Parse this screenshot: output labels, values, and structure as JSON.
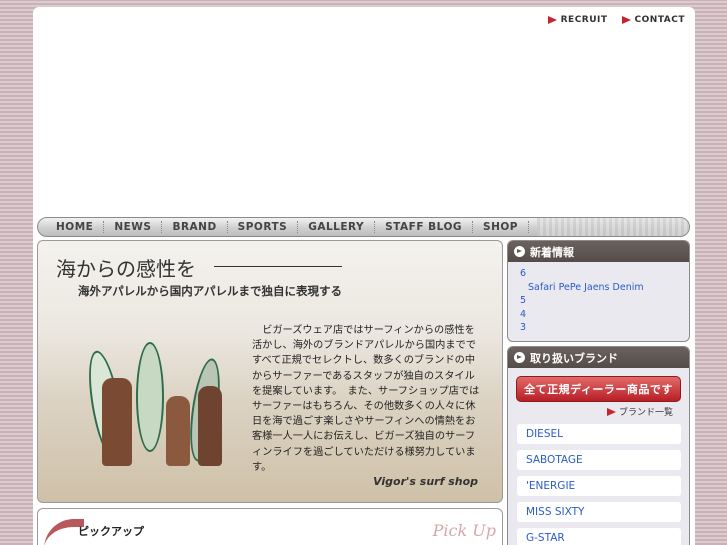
{
  "header": {
    "links": [
      "RECRUIT",
      "CONTACT"
    ]
  },
  "nav": {
    "items": [
      "HOME",
      "NEWS",
      "BRAND",
      "SPORTS",
      "GALLERY",
      "STAFF BLOG",
      "SHOP"
    ]
  },
  "hero": {
    "title": "海からの感性を",
    "subtitle": "海外アパレルから国内アパレルまで独自に表現する",
    "body": "ビガーズウェア店ではサーフィンからの感性を活かし、海外のブランドアパレルから国内までですべて正規でセレクトし、数多くのブランドの中からサーファーであるスタッフが独自のスタイルを提案しています。　また、サーフショップ店ではサーファーはもちろん、その他数多くの人々に休日を海で過ごす楽しさやサーフィンへの情熱をお客様一人一人にお伝えし、ビガーズ独自のサーフィンライフを過ごしていただける様努力しています。",
    "signature": "Vigor's surf shop"
  },
  "pickup": {
    "label": "ピックアップ",
    "en_label": "Pick Up"
  },
  "news": {
    "heading": "新着情報",
    "items": [
      "6",
      "Safari  PePe Jaens Denim",
      "5",
      "4",
      "3"
    ]
  },
  "brands": {
    "heading": "取り扱いブランド",
    "dealer_button": "全て正規ディーラー商品です",
    "list_link": "ブランド一覧",
    "items": [
      "DIESEL",
      "SABOTAGE",
      "'ENERGIE",
      "MISS SIXTY",
      "G-STAR"
    ]
  },
  "colors": {
    "accent_red": "#c8242b",
    "link_blue": "#2a5bc9",
    "header_brown": "#5f5653"
  }
}
